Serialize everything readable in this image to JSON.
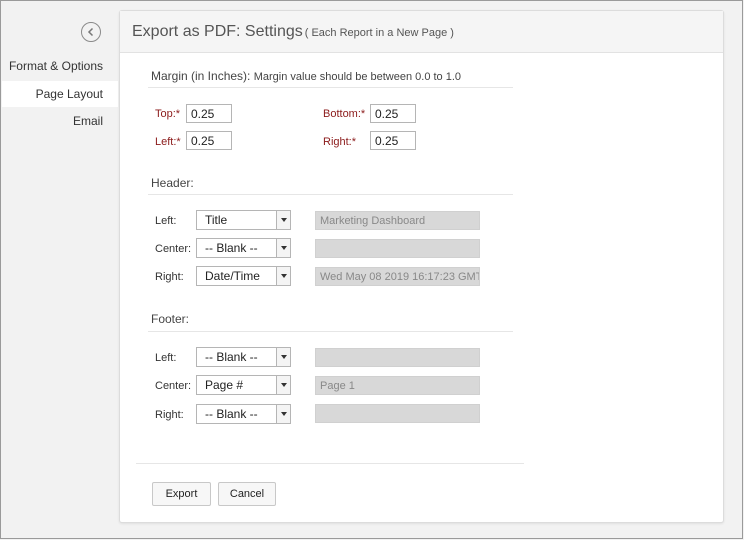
{
  "sidebar": {
    "items": [
      {
        "label": "Format & Options"
      },
      {
        "label": "Page Layout"
      },
      {
        "label": "Email"
      }
    ]
  },
  "header": {
    "title": "Export as PDF: Settings",
    "subtitle": "( Each Report in a New Page )"
  },
  "margin": {
    "title": "Margin (in Inches):",
    "hint": "Margin value should be between 0.0 to 1.0",
    "top_label": "Top:*",
    "top_value": "0.25",
    "bottom_label": "Bottom:*",
    "bottom_value": "0.25",
    "left_label": "Left:*",
    "left_value": "0.25",
    "right_label": "Right:*",
    "right_value": "0.25"
  },
  "header_section": {
    "title": "Header:",
    "rows": [
      {
        "label": "Left:",
        "select": "Title",
        "value": "Marketing Dashboard"
      },
      {
        "label": "Center:",
        "select": "-- Blank --",
        "value": ""
      },
      {
        "label": "Right:",
        "select": "Date/Time",
        "value": "Wed May 08 2019 16:17:23 GMT+"
      }
    ]
  },
  "footer_section": {
    "title": "Footer:",
    "rows": [
      {
        "label": "Left:",
        "select": "-- Blank --",
        "value": ""
      },
      {
        "label": "Center:",
        "select": "Page #",
        "value": "Page 1"
      },
      {
        "label": "Right:",
        "select": "-- Blank --",
        "value": ""
      }
    ]
  },
  "buttons": {
    "export": "Export",
    "cancel": "Cancel"
  },
  "colors": {
    "required_label": "#8b1a1a",
    "active_nav_bg": "#ffffff",
    "readonly_field_bg": "#d8d8d8"
  }
}
